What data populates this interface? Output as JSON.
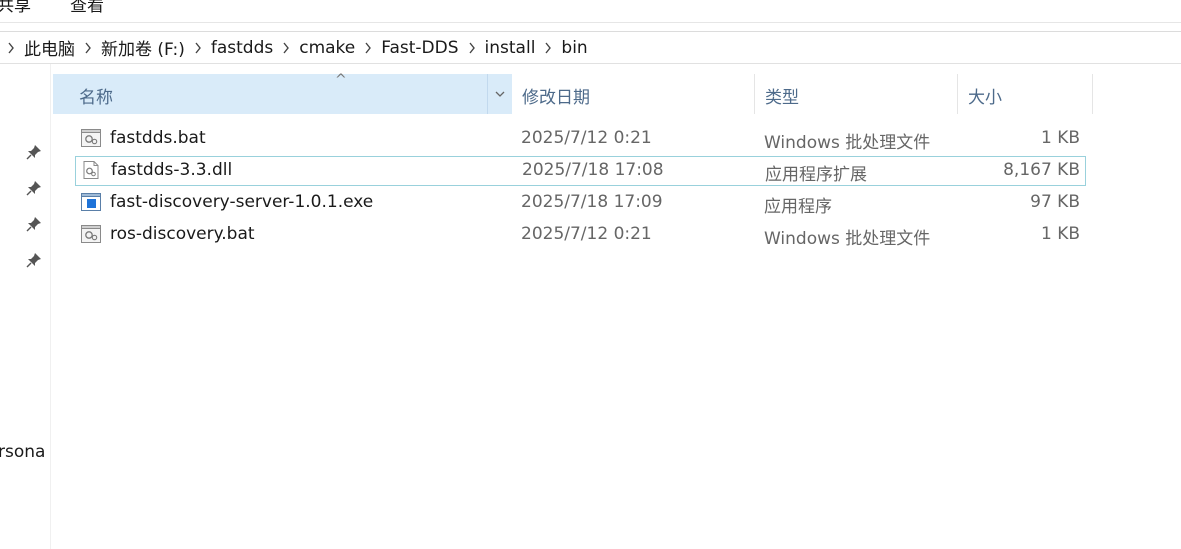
{
  "ribbon": {
    "tabs": [
      "共享",
      "查看"
    ]
  },
  "address": {
    "crumbs": [
      "此电脑",
      "新加卷 (F:)",
      "fastdds",
      "cmake",
      "Fast-DDS",
      "install",
      "bin"
    ]
  },
  "nav": {
    "partial_label": "rsona"
  },
  "columns": {
    "name": "名称",
    "date": "修改日期",
    "type": "类型",
    "size": "大小"
  },
  "files": [
    {
      "name": "fastdds.bat",
      "date": "2025/7/12 0:21",
      "type": "Windows 批处理文件",
      "size": "1 KB",
      "icon": "batch-file-icon"
    },
    {
      "name": "fastdds-3.3.dll",
      "date": "2025/7/18 17:08",
      "type": "应用程序扩展",
      "size": "8,167 KB",
      "icon": "dll-file-icon",
      "selected": true
    },
    {
      "name": "fast-discovery-server-1.0.1.exe",
      "date": "2025/7/18 17:09",
      "type": "应用程序",
      "size": "97 KB",
      "icon": "exe-file-icon"
    },
    {
      "name": "ros-discovery.bat",
      "date": "2025/7/12 0:21",
      "type": "Windows 批处理文件",
      "size": "1 KB",
      "icon": "batch-file-icon"
    }
  ],
  "colors": {
    "header_selected": "#d9ebf9",
    "selection_border": "#99d1dc",
    "header_text": "#4d6a8a"
  }
}
